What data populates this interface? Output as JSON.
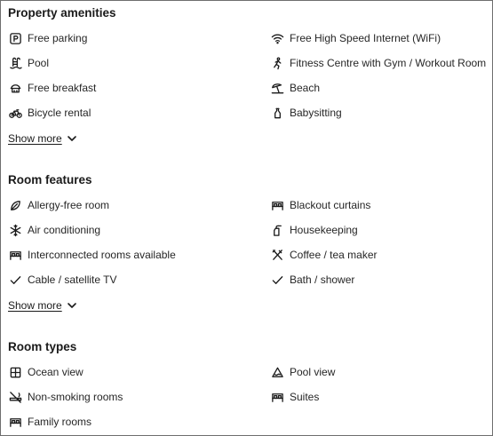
{
  "property_amenities": {
    "title": "Property amenities",
    "items": [
      {
        "icon": "parking-icon",
        "label": "Free parking"
      },
      {
        "icon": "wifi-icon",
        "label": "Free High Speed Internet (WiFi)"
      },
      {
        "icon": "pool-icon",
        "label": "Pool"
      },
      {
        "icon": "fitness-icon",
        "label": "Fitness Centre with Gym / Workout Room"
      },
      {
        "icon": "breakfast-icon",
        "label": "Free breakfast"
      },
      {
        "icon": "beach-icon",
        "label": "Beach"
      },
      {
        "icon": "bicycle-icon",
        "label": "Bicycle rental"
      },
      {
        "icon": "babysitting-icon",
        "label": "Babysitting"
      }
    ],
    "show_more": "Show more"
  },
  "room_features": {
    "title": "Room features",
    "items": [
      {
        "icon": "allergy-free-icon",
        "label": "Allergy-free room"
      },
      {
        "icon": "bed-icon",
        "label": "Blackout curtains"
      },
      {
        "icon": "snowflake-icon",
        "label": "Air conditioning"
      },
      {
        "icon": "housekeeping-icon",
        "label": "Housekeeping"
      },
      {
        "icon": "bed-icon",
        "label": "Interconnected rooms available"
      },
      {
        "icon": "utensils-icon",
        "label": "Coffee / tea maker"
      },
      {
        "icon": "check-icon",
        "label": "Cable / satellite TV"
      },
      {
        "icon": "check-icon",
        "label": "Bath / shower"
      }
    ],
    "show_more": "Show more"
  },
  "room_types": {
    "title": "Room types",
    "items": [
      {
        "icon": "ocean-view-icon",
        "label": "Ocean view"
      },
      {
        "icon": "pool-view-icon",
        "label": "Pool view"
      },
      {
        "icon": "non-smoking-icon",
        "label": "Non-smoking rooms"
      },
      {
        "icon": "bed-icon",
        "label": "Suites"
      },
      {
        "icon": "bed-icon",
        "label": "Family rooms"
      }
    ]
  }
}
